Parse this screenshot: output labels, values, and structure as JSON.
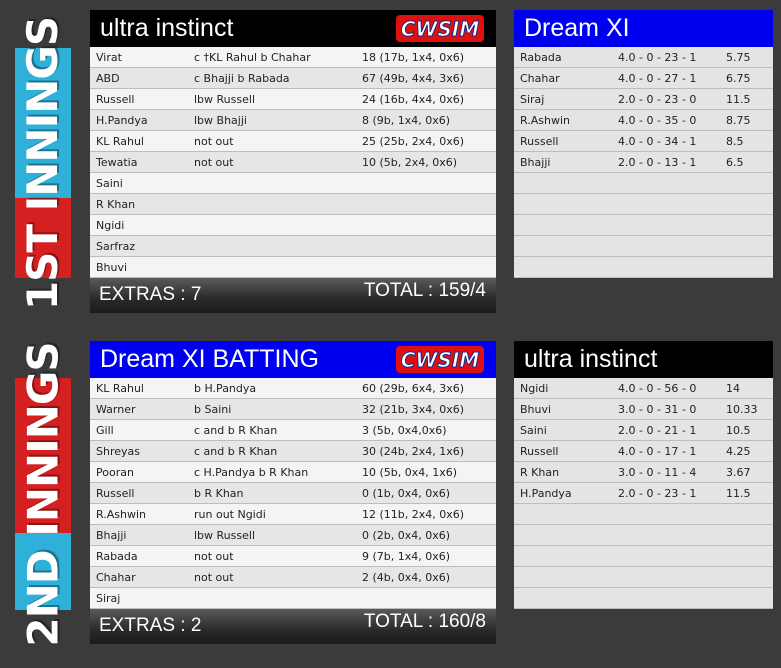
{
  "innings": [
    {
      "tab_label": "1ST INNINGS",
      "batting": {
        "team": "ultra instinct",
        "logo_text": "CWSIM",
        "rows": [
          {
            "name": "Virat",
            "how": "c †KL Rahul b Chahar",
            "score": "18 (17b, 1x4, 0x6)"
          },
          {
            "name": "ABD",
            "how": "c Bhajji b Rabada",
            "score": "67 (49b, 4x4, 3x6)"
          },
          {
            "name": "Russell",
            "how": "lbw Russell",
            "score": "24 (16b, 4x4, 0x6)"
          },
          {
            "name": "H.Pandya",
            "how": "lbw Bhajji",
            "score": "8 (9b, 1x4, 0x6)"
          },
          {
            "name": "KL Rahul",
            "how": "not out",
            "score": "25 (25b, 2x4, 0x6)"
          },
          {
            "name": "Tewatia",
            "how": "not out",
            "score": "10 (5b, 2x4, 0x6)"
          },
          {
            "name": "Saini",
            "how": "",
            "score": ""
          },
          {
            "name": "R Khan",
            "how": "",
            "score": ""
          },
          {
            "name": "Ngidi",
            "how": "",
            "score": ""
          },
          {
            "name": "Sarfraz",
            "how": "",
            "score": ""
          },
          {
            "name": "Bhuvi",
            "how": "",
            "score": ""
          }
        ],
        "extras": "EXTRAS : 7",
        "total": "TOTAL : 159/4"
      },
      "bowling": {
        "team": "Dream XI",
        "rows": [
          {
            "name": "Rabada",
            "figures": "4.0 - 0 - 23 - 1",
            "econ": "5.75"
          },
          {
            "name": "Chahar",
            "figures": "4.0 - 0 - 27 - 1",
            "econ": "6.75"
          },
          {
            "name": "Siraj",
            "figures": "2.0 - 0 - 23 - 0",
            "econ": "11.5"
          },
          {
            "name": "R.Ashwin",
            "figures": "4.0 - 0 - 35 - 0",
            "econ": "8.75"
          },
          {
            "name": "Russell",
            "figures": "4.0 - 0 - 34 - 1",
            "econ": "8.5"
          },
          {
            "name": "Bhajji",
            "figures": "2.0 - 0 - 13 - 1",
            "econ": "6.5"
          }
        ]
      }
    },
    {
      "tab_label": "2ND INNINGS",
      "batting": {
        "team": "Dream XI BATTING",
        "logo_text": "CWSIM",
        "rows": [
          {
            "name": "KL Rahul",
            "how": "b H.Pandya",
            "score": "60 (29b, 6x4, 3x6)"
          },
          {
            "name": "Warner",
            "how": "b Saini",
            "score": "32 (21b, 3x4, 0x6)"
          },
          {
            "name": "Gill",
            "how": "c and b R Khan",
            "score": "3 (5b, 0x4,0x6)"
          },
          {
            "name": "Shreyas",
            "how": "c and b R Khan",
            "score": "30 (24b, 2x4, 1x6)"
          },
          {
            "name": "Pooran",
            "how": "c H.Pandya b R Khan",
            "score": "10 (5b, 0x4, 1x6)"
          },
          {
            "name": "Russell",
            "how": "b R Khan",
            "score": "0 (1b, 0x4, 0x6)"
          },
          {
            "name": "R.Ashwin",
            "how": "run out Ngidi",
            "score": "12 (11b, 2x4, 0x6)"
          },
          {
            "name": "Bhajji",
            "how": "lbw Russell",
            "score": "0 (2b, 0x4, 0x6)"
          },
          {
            "name": "Rabada",
            "how": "not out",
            "score": "9 (7b, 1x4, 0x6)"
          },
          {
            "name": "Chahar",
            "how": "not out",
            "score": "2 (4b, 0x4, 0x6)"
          },
          {
            "name": "Siraj",
            "how": "",
            "score": ""
          }
        ],
        "extras": "EXTRAS : 2",
        "total": "TOTAL : 160/8"
      },
      "bowling": {
        "team": "ultra instinct",
        "rows": [
          {
            "name": "Ngidi",
            "figures": "4.0 - 0 - 56 - 0",
            "econ": "14"
          },
          {
            "name": "Bhuvi",
            "figures": "3.0 - 0 - 31 - 0",
            "econ": "10.33"
          },
          {
            "name": "Saini",
            "figures": "2.0 - 0 - 21 - 1",
            "econ": "10.5"
          },
          {
            "name": "Russell",
            "figures": "4.0 - 0 - 17 - 1",
            "econ": "4.25"
          },
          {
            "name": "R Khan",
            "figures": "3.0 - 0 - 11 - 4",
            "econ": "3.67"
          },
          {
            "name": "H.Pandya",
            "figures": "2.0 - 0 - 23 - 1",
            "econ": "11.5"
          }
        ]
      }
    }
  ],
  "colors": {
    "tab_top": "#2fb0d8",
    "tab_bottom": "#d42020",
    "head_blue": "#0000f0",
    "head_black": "#000000",
    "logo_red": "#e01010"
  }
}
